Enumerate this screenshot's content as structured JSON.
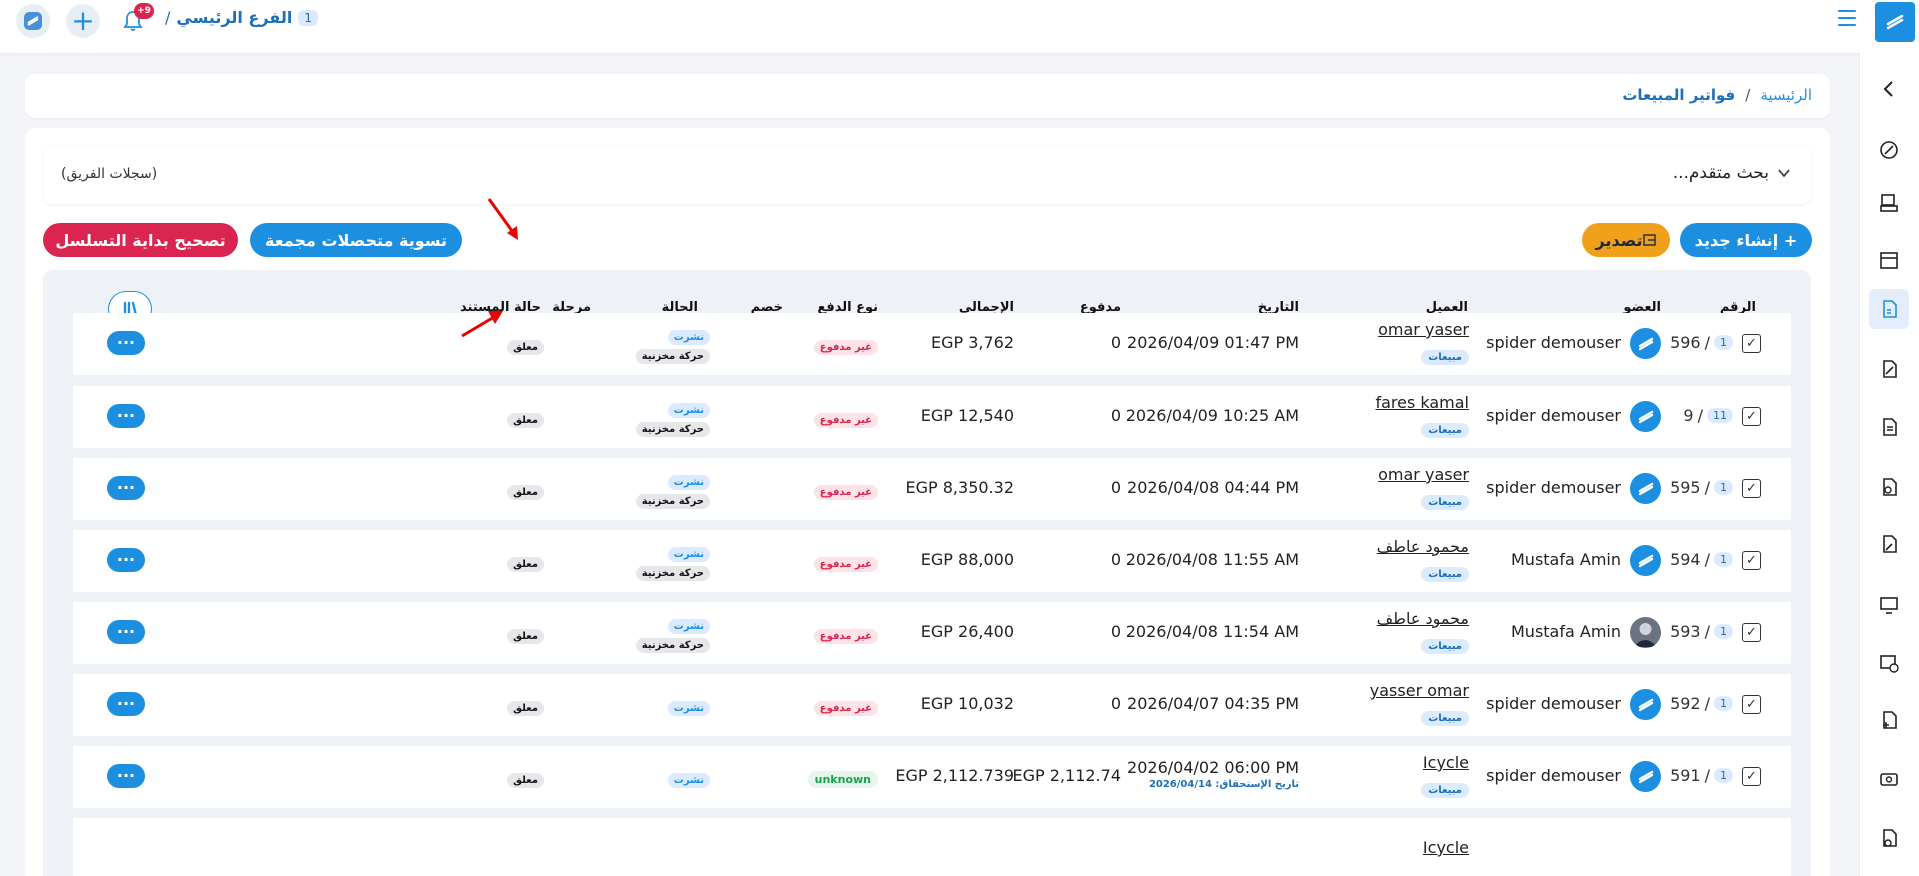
{
  "header": {
    "branch_number": "1",
    "branch_name": "الفرع الرئيسي",
    "branch_sep": "/",
    "notifications_badge": "+9"
  },
  "breadcrumb": {
    "home": "الرئيسية",
    "separator": "/",
    "current": "فواتير المبيعات"
  },
  "search": {
    "advanced_label": "بحث متقدم...",
    "team_log": "(سجلات الفريق)"
  },
  "toolbar": {
    "create_label": "+ إنشاء جديد",
    "export_label": "تصدير",
    "settle_label": "تسوية متحصلات مجمعة",
    "fix_label": "تصحيح بداية التسلسل"
  },
  "table": {
    "headers": {
      "number": "الرقم",
      "member": "العضو",
      "client": "العميل",
      "date": "التاريخ",
      "paid": "مدفوع",
      "total": "الإجمالى",
      "payment_type": "نوع الدفع",
      "discount": "خصم",
      "status": "الحالة",
      "stage": "مرحلة",
      "doc_status": "حالة المستند"
    },
    "rows": [
      {
        "num": "596",
        "branch": "1",
        "member": "spider demouser",
        "client": "omar yaser",
        "client_tag": "مبيعات",
        "date": "2026/04/09 01:47 PM",
        "due": "",
        "paid": "0",
        "total": "EGP 3,762",
        "payment": "غير مدفوع",
        "status1": "نشرت",
        "status2": "حركة مخزنية",
        "doc_status": "معلق"
      },
      {
        "num": "9",
        "branch": "11",
        "member": "spider demouser",
        "client": "fares kamal",
        "client_tag": "مبيعات",
        "date": "2026/04/09 10:25 AM",
        "due": "",
        "paid": "0",
        "total": "EGP 12,540",
        "payment": "غير مدفوع",
        "status1": "نشرت",
        "status2": "حركة مخزنية",
        "doc_status": "معلق"
      },
      {
        "num": "595",
        "branch": "1",
        "member": "spider demouser",
        "client": "omar yaser",
        "client_tag": "مبيعات",
        "date": "2026/04/08 04:44 PM",
        "due": "",
        "paid": "0",
        "total": "EGP 8,350.32",
        "payment": "غير مدفوع",
        "status1": "نشرت",
        "status2": "حركة مخزنية",
        "doc_status": "معلق"
      },
      {
        "num": "594",
        "branch": "1",
        "member": "Mustafa Amin",
        "client": "محمود عاطف",
        "client_tag": "مبيعات",
        "date": "2026/04/08 11:55 AM",
        "due": "",
        "paid": "0",
        "total": "EGP 88,000",
        "payment": "غير مدفوع",
        "status1": "نشرت",
        "status2": "حركة مخزنية",
        "doc_status": "معلق"
      },
      {
        "num": "593",
        "branch": "1",
        "member": "Mustafa Amin",
        "client": "محمود عاطف",
        "client_tag": "مبيعات",
        "date": "2026/04/08 11:54 AM",
        "due": "",
        "paid": "0",
        "total": "EGP 26,400",
        "payment": "غير مدفوع",
        "status1": "نشرت",
        "status2": "حركة مخزنية",
        "doc_status": "معلق"
      },
      {
        "num": "592",
        "branch": "1",
        "member": "spider demouser",
        "client": "yasser omar",
        "client_tag": "مبيعات",
        "date": "2026/04/07 04:35 PM",
        "due": "",
        "paid": "0",
        "total": "EGP 10,032",
        "payment": "غير مدفوع",
        "status1": "نشرت",
        "status2": "",
        "doc_status": "معلق"
      },
      {
        "num": "591",
        "branch": "1",
        "member": "spider demouser",
        "client": "Icycle",
        "client_tag": "مبيعات",
        "date": "2026/04/02 06:00 PM",
        "due": "تاريخ الإستحقاق: 2026/04/14",
        "paid": "EGP 2,112.74",
        "total": "EGP 2,112.739",
        "payment": "unknown",
        "status1": "نشرت",
        "status2": "",
        "doc_status": "معلق"
      },
      {
        "num": "",
        "branch": "",
        "member": "",
        "client": "Icycle",
        "client_tag": "",
        "date": "",
        "due": "",
        "paid": "",
        "total": "",
        "payment": "",
        "status1": "",
        "status2": "",
        "doc_status": ""
      }
    ]
  },
  "colors": {
    "primary": "#1d8fe1",
    "danger": "#d9254f",
    "warning": "#f0a11b",
    "success": "#18a34a"
  }
}
